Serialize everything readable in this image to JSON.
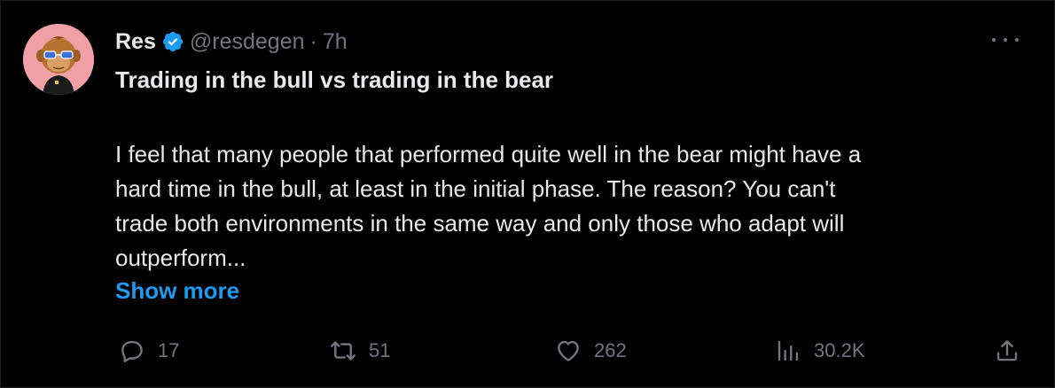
{
  "tweet": {
    "author_name": "Res",
    "handle": "@resdegen",
    "separator": "·",
    "time": "7h",
    "title": "Trading in the bull vs trading in the bear",
    "body_lines": [
      "I feel that many people that performed quite well in the bear might have a",
      "hard time in the bull, at least in the initial phase. The reason? You can't",
      "trade both environments in the same way and only those who adapt will",
      "outperform..."
    ],
    "show_more": "Show more"
  },
  "actions": {
    "reply_count": "17",
    "retweet_count": "51",
    "like_count": "262",
    "views_count": "30.2K"
  },
  "icons": {
    "verified": "verified-badge-icon",
    "more": "more-dots-icon",
    "reply": "reply-icon",
    "retweet": "retweet-icon",
    "like": "heart-icon",
    "views": "views-chart-icon",
    "share": "share-icon"
  },
  "colors": {
    "background": "#000000",
    "text": "#e7e9ea",
    "muted": "#71767b",
    "accent": "#1d9bf0",
    "avatar_bg": "#f1a0a5"
  }
}
